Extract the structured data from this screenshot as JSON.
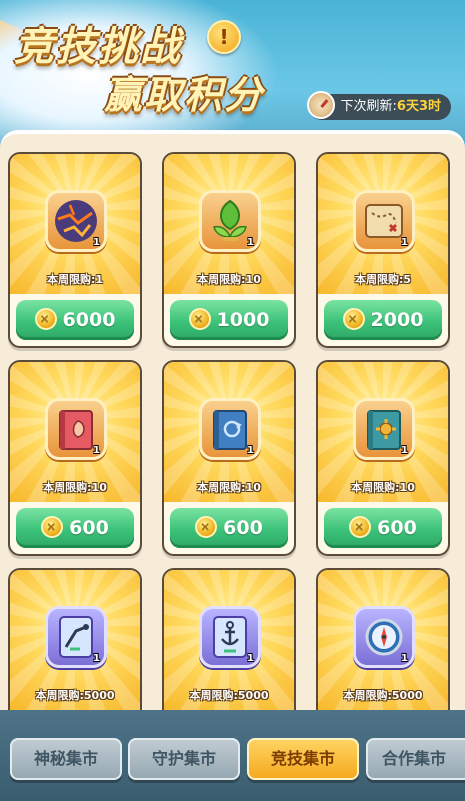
{
  "header": {
    "title_line1": "竞技挑战",
    "title_line2": "赢取积分",
    "info_icon": "!",
    "refresh_label": "下次刷新:",
    "refresh_value": "6天3时"
  },
  "currency_icon": "arena-coin-icon",
  "items": [
    {
      "icon": "lava-stone-icon",
      "quantity": "1",
      "limit": "本周限购:1",
      "price": "6000"
    },
    {
      "icon": "leaf-crest-icon",
      "quantity": "1",
      "limit": "本周限购:10",
      "price": "1000"
    },
    {
      "icon": "treasure-map-icon",
      "quantity": "1",
      "limit": "本周限购:5",
      "price": "2000"
    },
    {
      "icon": "red-shell-book-icon",
      "quantity": "1",
      "limit": "本周限购:10",
      "price": "600"
    },
    {
      "icon": "blue-recycle-book-icon",
      "quantity": "1",
      "limit": "本周限购:10",
      "price": "600"
    },
    {
      "icon": "teal-gear-book-icon",
      "quantity": "1",
      "limit": "本周限购:10",
      "price": "600"
    },
    {
      "icon": "catapult-card-icon",
      "quantity": "1",
      "limit": "本周限购:5000"
    },
    {
      "icon": "anchor-card-icon",
      "quantity": "1",
      "limit": "本周限购:5000"
    },
    {
      "icon": "compass-icon",
      "quantity": "1",
      "limit": "本周限购:5000"
    }
  ],
  "tabs": [
    {
      "label": "神秘集市",
      "active": false
    },
    {
      "label": "守护集市",
      "active": false
    },
    {
      "label": "竞技集市",
      "active": true
    },
    {
      "label": "合作集市",
      "active": false
    }
  ],
  "colors": {
    "price_button": "#3cc27a",
    "active_tab": "#f5a91f",
    "panel": "#f6ecd7"
  }
}
